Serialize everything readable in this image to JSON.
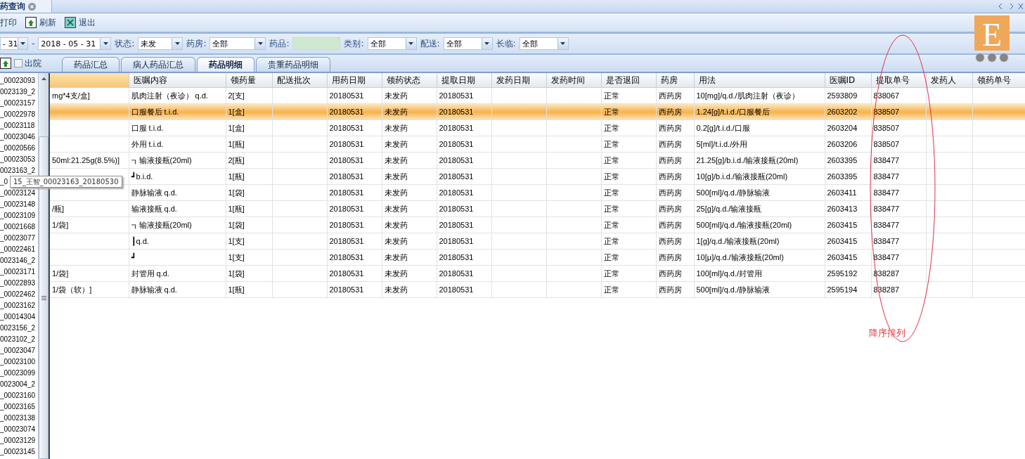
{
  "window": {
    "title": "药查询"
  },
  "toolbar": [
    "打印",
    "刷新",
    "退出"
  ],
  "filters": [
    {
      "kind": "date",
      "value": "- 31"
    },
    {
      "kind": "separator",
      "text": "-"
    },
    {
      "kind": "date",
      "value": "2018 - 05 - 31"
    },
    {
      "kind": "select",
      "label": "状态:",
      "value": "未发"
    },
    {
      "kind": "select",
      "label": "药房:",
      "value": "全部"
    },
    {
      "kind": "text",
      "label": "药品:"
    },
    {
      "kind": "select",
      "label": "类别:",
      "value": "全部"
    },
    {
      "kind": "select",
      "label": "配送:",
      "value": "全部"
    },
    {
      "kind": "select",
      "label": "长临:",
      "value": "全部"
    }
  ],
  "discharged": {
    "label": "出院",
    "checked": false
  },
  "tabs": [
    {
      "label": "药品汇总",
      "selected": false
    },
    {
      "label": "病人药品汇总",
      "selected": false
    },
    {
      "label": "药品明细",
      "selected": true
    },
    {
      "label": "贵重药品明细",
      "selected": false
    }
  ],
  "patients": [
    "_00023093",
    "0023139_2",
    "_00023157",
    "_00022978",
    "_00023118",
    "_00023046",
    "_00020566",
    "_00023053",
    "0023163_2",
    "_0",
    "_00023124",
    "_00023148",
    "_00023109",
    "_00021668",
    "_00023077",
    "_00022461",
    "0023146_2",
    "_00023171",
    "_00022893",
    "_00022462",
    "_00023162",
    "_00014304",
    "0023156_2",
    "0023102_2",
    "_00023047",
    "_00023100",
    "_00023099",
    "0023004_2",
    "_00023160",
    "_00023165",
    "_00023138",
    "_00023074",
    "_00023129",
    "_00023145"
  ],
  "tooltip": "15_王智_00023163_20180530",
  "table": {
    "columns": [
      "",
      "医嘱内容",
      "领药量",
      "配送批次",
      "用药日期",
      "领药状态",
      "提取日期",
      "发药日期",
      "发药时间",
      "是否退回",
      "药房",
      "用法",
      "医嘱ID",
      "提取单号",
      "发药人",
      "领药单号"
    ],
    "rows": [
      {
        "selected": false,
        "cells": [
          "mg*4支/盒]",
          "肌肉注射（夜诊） q.d.",
          "2[支]",
          "",
          "20180531",
          "未发药",
          "20180531",
          "",
          "",
          "正常",
          "西药房",
          "10[mg]/q.d./肌肉注射（夜诊）",
          "2593809",
          "838067",
          "",
          ""
        ]
      },
      {
        "selected": true,
        "cells": [
          "",
          "口服餐后 t.i.d.",
          "1[盒]",
          "",
          "20180531",
          "未发药",
          "20180531",
          "",
          "",
          "正常",
          "西药房",
          "1.24[g]/t.i.d./口服餐后",
          "2603202",
          "838507",
          "",
          ""
        ]
      },
      {
        "selected": false,
        "cells": [
          "",
          "口服 t.i.d.",
          "1[盒]",
          "",
          "20180531",
          "未发药",
          "20180531",
          "",
          "",
          "正常",
          "西药房",
          "0.2[g]/t.i.d./口服",
          "2603204",
          "838507",
          "",
          ""
        ]
      },
      {
        "selected": false,
        "cells": [
          "",
          "外用 t.i.d.",
          "1[瓶]",
          "",
          "20180531",
          "未发药",
          "20180531",
          "",
          "",
          "正常",
          "西药房",
          "5[ml]/t.i.d./外用",
          "2603206",
          "838507",
          "",
          ""
        ]
      },
      {
        "selected": false,
        "cells": [
          "50ml:21.25g(8.5%)]",
          "┓输液接瓶(20ml)",
          "2[瓶]",
          "",
          "20180531",
          "未发药",
          "20180531",
          "",
          "",
          "正常",
          "西药房",
          "21.25[g]/b.i.d./输液接瓶(20ml)",
          "2603395",
          "838477",
          "",
          ""
        ]
      },
      {
        "selected": false,
        "cells": [
          "",
          "┛b.i.d.",
          "1[瓶]",
          "",
          "20180531",
          "未发药",
          "20180531",
          "",
          "",
          "正常",
          "西药房",
          "10[g]/b.i.d./输液接瓶(20ml)",
          "2603395",
          "838477",
          "",
          ""
        ]
      },
      {
        "selected": false,
        "cells": [
          "",
          "静脉输液 q.d.",
          "1[袋]",
          "",
          "20180531",
          "未发药",
          "20180531",
          "",
          "",
          "正常",
          "西药房",
          "500[ml]/q.d./静脉输液",
          "2603411",
          "838477",
          "",
          ""
        ]
      },
      {
        "selected": false,
        "cells": [
          "/瓶]",
          "输液接瓶 q.d.",
          "1[瓶]",
          "",
          "20180531",
          "未发药",
          "20180531",
          "",
          "",
          "正常",
          "西药房",
          "25[g]/q.d./输液接瓶",
          "2603413",
          "838477",
          "",
          ""
        ]
      },
      {
        "selected": false,
        "cells": [
          "1/袋]",
          "┓输液接瓶(20ml)",
          "1[袋]",
          "",
          "20180531",
          "未发药",
          "20180531",
          "",
          "",
          "正常",
          "西药房",
          "500[ml]/q.d./输液接瓶(20ml)",
          "2603415",
          "838477",
          "",
          ""
        ]
      },
      {
        "selected": false,
        "cells": [
          "",
          "┃q.d.",
          "1[支]",
          "",
          "20180531",
          "未发药",
          "20180531",
          "",
          "",
          "正常",
          "西药房",
          "1[g]/q.d./输液接瓶(20ml)",
          "2603415",
          "838477",
          "",
          ""
        ]
      },
      {
        "selected": false,
        "cells": [
          "",
          "┛",
          "1[支]",
          "",
          "20180531",
          "未发药",
          "20180531",
          "",
          "",
          "正常",
          "西药房",
          "10[μ]/q.d./输液接瓶(20ml)",
          "2603415",
          "838477",
          "",
          ""
        ]
      },
      {
        "selected": false,
        "cells": [
          "1/袋]",
          "封管用 q.d.",
          "1[袋]",
          "",
          "20180531",
          "未发药",
          "20180531",
          "",
          "",
          "正常",
          "西药房",
          "100[ml]/q.d./封管用",
          "2595192",
          "838287",
          "",
          ""
        ]
      },
      {
        "selected": false,
        "cells": [
          "1/袋（软）]",
          "静脉输液 q.d.",
          "1[瓶]",
          "",
          "20180531",
          "未发药",
          "20180531",
          "",
          "",
          "正常",
          "西药房",
          "500[ml]/q.d./静脉输液",
          "2595194",
          "838287",
          "",
          ""
        ]
      }
    ]
  },
  "logo": {
    "letter": "E"
  },
  "annotation": "降序排列"
}
